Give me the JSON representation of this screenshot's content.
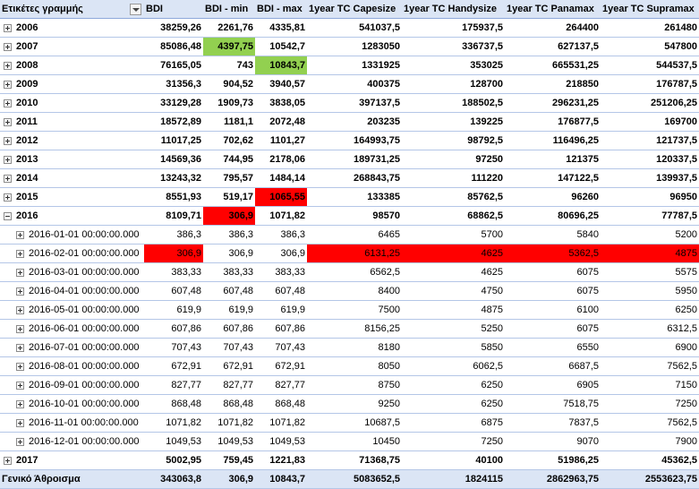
{
  "columns": {
    "row_labels": "Ετικέτες γραμμής",
    "bdi": "BDI",
    "bdi_min": "BDI - min",
    "bdi_max": "BDI - max",
    "capesize": "1year TC Capesize",
    "handysize": "1year TC Handysize",
    "panamax": "1year TC Panamax",
    "supramax": "1year TC Supramax"
  },
  "highlight_colors": {
    "red": "#ff0000",
    "green": "#92d050"
  },
  "rows": [
    {
      "level": "year",
      "expand": "plus",
      "label": "2006",
      "cells": [
        "38259,26",
        "2261,76",
        "4335,81",
        "541037,5",
        "175937,5",
        "264400",
        "261480"
      ],
      "hl": []
    },
    {
      "level": "year",
      "expand": "plus",
      "label": "2007",
      "cells": [
        "85086,48",
        "4397,75",
        "10542,7",
        "1283050",
        "336737,5",
        "627137,5",
        "547800"
      ],
      "hl": [
        null,
        "green"
      ]
    },
    {
      "level": "year",
      "expand": "plus",
      "label": "2008",
      "cells": [
        "76165,05",
        "743",
        "10843,7",
        "1331925",
        "353025",
        "665531,25",
        "544537,5"
      ],
      "hl": [
        null,
        null,
        "green"
      ]
    },
    {
      "level": "year",
      "expand": "plus",
      "label": "2009",
      "cells": [
        "31356,3",
        "904,52",
        "3940,57",
        "400375",
        "128700",
        "218850",
        "176787,5"
      ],
      "hl": []
    },
    {
      "level": "year",
      "expand": "plus",
      "label": "2010",
      "cells": [
        "33129,28",
        "1909,73",
        "3838,05",
        "397137,5",
        "188502,5",
        "296231,25",
        "251206,25"
      ],
      "hl": []
    },
    {
      "level": "year",
      "expand": "plus",
      "label": "2011",
      "cells": [
        "18572,89",
        "1181,1",
        "2072,48",
        "203235",
        "139225",
        "176877,5",
        "169700"
      ],
      "hl": []
    },
    {
      "level": "year",
      "expand": "plus",
      "label": "2012",
      "cells": [
        "11017,25",
        "702,62",
        "1101,27",
        "164993,75",
        "98792,5",
        "116496,25",
        "121737,5"
      ],
      "hl": []
    },
    {
      "level": "year",
      "expand": "plus",
      "label": "2013",
      "cells": [
        "14569,36",
        "744,95",
        "2178,06",
        "189731,25",
        "97250",
        "121375",
        "120337,5"
      ],
      "hl": []
    },
    {
      "level": "year",
      "expand": "plus",
      "label": "2014",
      "cells": [
        "13243,32",
        "795,57",
        "1484,14",
        "268843,75",
        "111220",
        "147122,5",
        "139937,5"
      ],
      "hl": []
    },
    {
      "level": "year",
      "expand": "plus",
      "label": "2015",
      "cells": [
        "8551,93",
        "519,17",
        "1065,55",
        "133385",
        "85762,5",
        "96260",
        "96950"
      ],
      "hl": [
        null,
        null,
        "red"
      ]
    },
    {
      "level": "year",
      "expand": "minus",
      "label": "2016",
      "cells": [
        "8109,71",
        "306,9",
        "1071,82",
        "98570",
        "68862,5",
        "80696,25",
        "77787,5"
      ],
      "hl": [
        null,
        "red"
      ]
    },
    {
      "level": "month",
      "expand": "plus",
      "label": "2016-01-01 00:00:00.000",
      "cells": [
        "386,3",
        "386,3",
        "386,3",
        "6465",
        "5700",
        "5840",
        "5200"
      ],
      "hl": []
    },
    {
      "level": "month",
      "expand": "plus",
      "label": "2016-02-01 00:00:00.000",
      "cells": [
        "306,9",
        "306,9",
        "306,9",
        "6131,25",
        "4625",
        "5362,5",
        "4875"
      ],
      "hl": [
        "red",
        null,
        null,
        "red",
        "red",
        "red",
        "red"
      ]
    },
    {
      "level": "month",
      "expand": "plus",
      "label": "2016-03-01 00:00:00.000",
      "cells": [
        "383,33",
        "383,33",
        "383,33",
        "6562,5",
        "4625",
        "6075",
        "5575"
      ],
      "hl": []
    },
    {
      "level": "month",
      "expand": "plus",
      "label": "2016-04-01 00:00:00.000",
      "cells": [
        "607,48",
        "607,48",
        "607,48",
        "8400",
        "4750",
        "6075",
        "5950"
      ],
      "hl": []
    },
    {
      "level": "month",
      "expand": "plus",
      "label": "2016-05-01 00:00:00.000",
      "cells": [
        "619,9",
        "619,9",
        "619,9",
        "7500",
        "4875",
        "6100",
        "6250"
      ],
      "hl": []
    },
    {
      "level": "month",
      "expand": "plus",
      "label": "2016-06-01 00:00:00.000",
      "cells": [
        "607,86",
        "607,86",
        "607,86",
        "8156,25",
        "5250",
        "6075",
        "6312,5"
      ],
      "hl": []
    },
    {
      "level": "month",
      "expand": "plus",
      "label": "2016-07-01 00:00:00.000",
      "cells": [
        "707,43",
        "707,43",
        "707,43",
        "8180",
        "5850",
        "6550",
        "6900"
      ],
      "hl": []
    },
    {
      "level": "month",
      "expand": "plus",
      "label": "2016-08-01 00:00:00.000",
      "cells": [
        "672,91",
        "672,91",
        "672,91",
        "8050",
        "6062,5",
        "6687,5",
        "7562,5"
      ],
      "hl": []
    },
    {
      "level": "month",
      "expand": "plus",
      "label": "2016-09-01 00:00:00.000",
      "cells": [
        "827,77",
        "827,77",
        "827,77",
        "8750",
        "6250",
        "6905",
        "7150"
      ],
      "hl": []
    },
    {
      "level": "month",
      "expand": "plus",
      "label": "2016-10-01 00:00:00.000",
      "cells": [
        "868,48",
        "868,48",
        "868,48",
        "9250",
        "6250",
        "7518,75",
        "7250"
      ],
      "hl": []
    },
    {
      "level": "month",
      "expand": "plus",
      "label": "2016-11-01 00:00:00.000",
      "cells": [
        "1071,82",
        "1071,82",
        "1071,82",
        "10687,5",
        "6875",
        "7837,5",
        "7562,5"
      ],
      "hl": []
    },
    {
      "level": "month",
      "expand": "plus",
      "label": "2016-12-01 00:00:00.000",
      "cells": [
        "1049,53",
        "1049,53",
        "1049,53",
        "10450",
        "7250",
        "9070",
        "7900"
      ],
      "hl": []
    },
    {
      "level": "year",
      "expand": "plus",
      "label": "2017",
      "cells": [
        "5002,95",
        "759,45",
        "1221,83",
        "71368,75",
        "40100",
        "51986,25",
        "45362,5"
      ],
      "hl": []
    }
  ],
  "grand_total": {
    "label": "Γενικό Άθροισμα",
    "cells": [
      "343063,8",
      "306,9",
      "10843,7",
      "5083652,5",
      "1824115",
      "2862963,75",
      "2553623,75"
    ]
  }
}
